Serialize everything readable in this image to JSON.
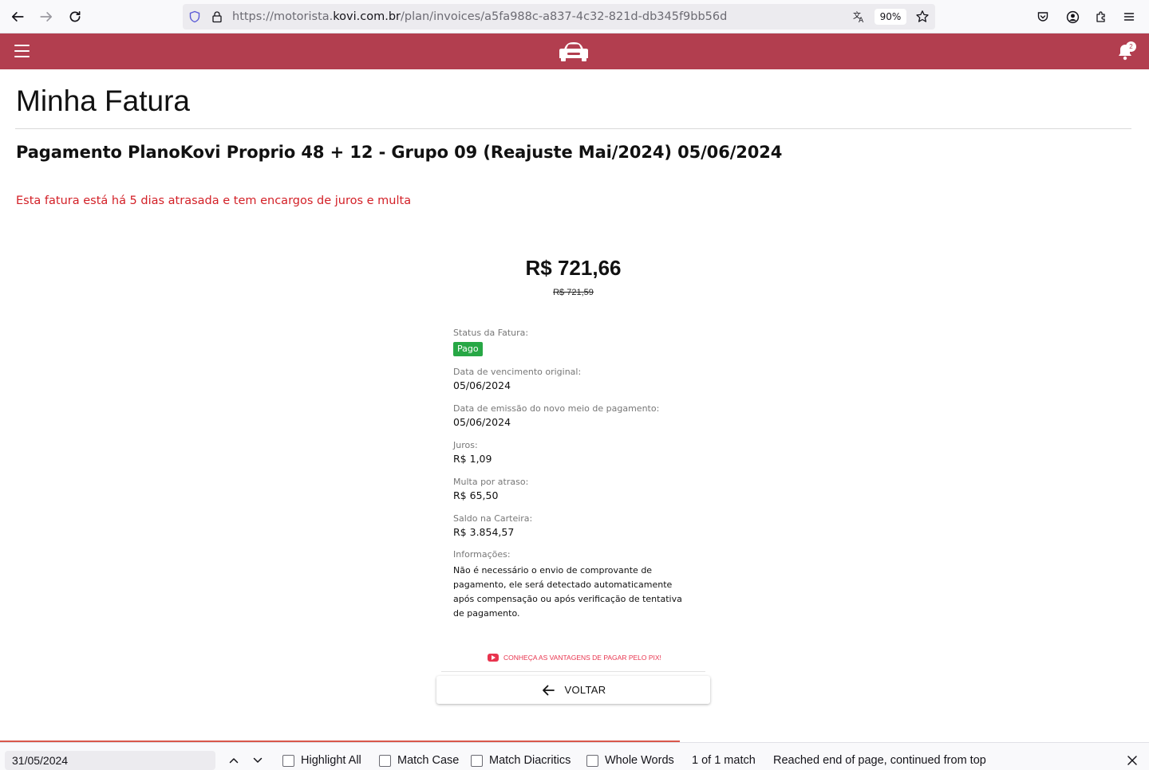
{
  "browser": {
    "url_prefix": "https://motorista.",
    "url_host": "kovi.com.br",
    "url_path": "/plan/invoices/a5fa988c-a837-4c32-821d-db345f9bb56d",
    "zoom": "90%",
    "icons": [
      "back-icon",
      "forward-icon",
      "reload-icon",
      "shield-icon",
      "lock-icon",
      "translate-icon",
      "star-icon",
      "pocket-icon",
      "account-icon",
      "extensions-icon",
      "menu-icon"
    ]
  },
  "header": {
    "brand_color": "#b23e4f",
    "notification_count": "2"
  },
  "page": {
    "title": "Minha Fatura",
    "invoice_name": "Pagamento PlanoKovi Proprio 48 + 12 - Grupo 09 (Reajuste Mai/2024) 05/06/2024",
    "late_warning": "Esta fatura está há 5 dias atrasada e tem encargos de juros e multa",
    "amount": "R$ 721,66",
    "original_amount": "R$ 721,59"
  },
  "details": {
    "status_label": "Status da Fatura:",
    "status_value": "Pago",
    "status_color": "#27a745",
    "due_label": "Data de vencimento original:",
    "due_value": "05/06/2024",
    "issue_label": "Data de emissão do novo meio de pagamento:",
    "issue_value": "05/06/2024",
    "interest_label": "Juros:",
    "interest_value": "R$ 1,09",
    "fine_label": "Multa por atraso:",
    "fine_value": "R$ 65,50",
    "wallet_label": "Saldo na Carteira:",
    "wallet_value": "R$ 3.854,57",
    "info_label": "Informações:",
    "info_text": "Não é necessário o envio de comprovante de pagamento, ele será detectado automaticamente após compensação ou após verificação de tentativa de pagamento."
  },
  "actions": {
    "pix_link": "CONHEÇA AS VANTAGENS DE PAGAR PELO PIX!",
    "back_button": "VOLTAR"
  },
  "findbar": {
    "query": "31/05/2024",
    "highlight_all": "Highlight All",
    "match_case": "Match Case",
    "match_diacritics": "Match Diacritics",
    "whole_words": "Whole Words",
    "match_count": "1 of 1 match",
    "status": "Reached end of page, continued from top"
  }
}
